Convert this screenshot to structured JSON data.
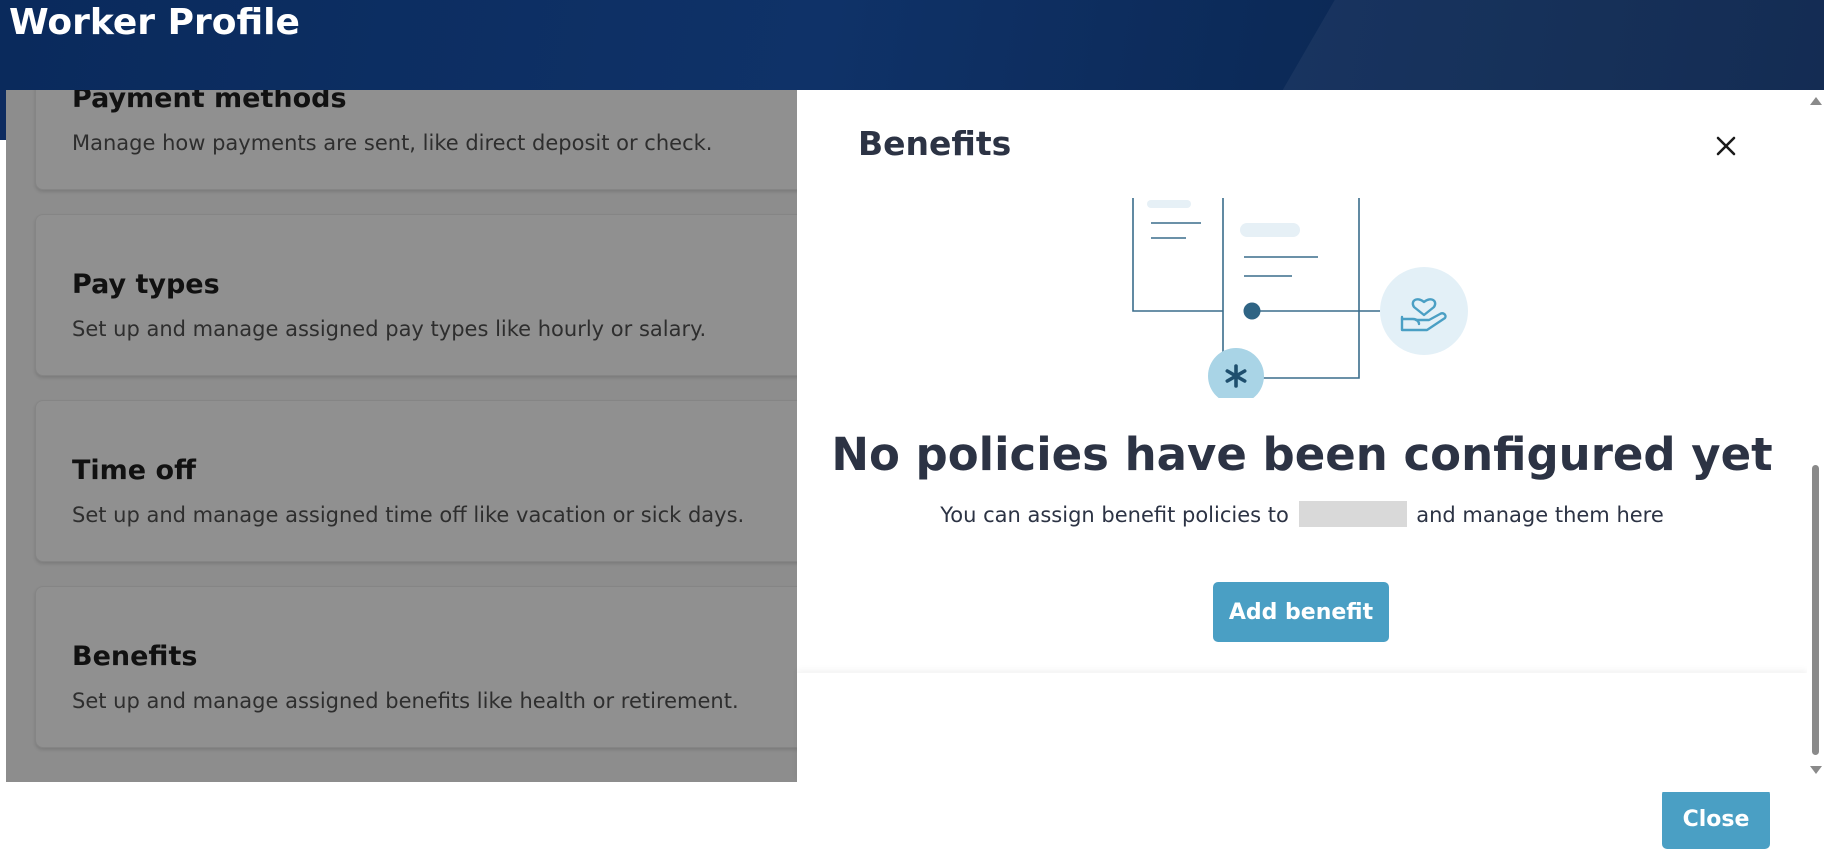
{
  "header": {
    "title": "Worker Profile"
  },
  "cards": [
    {
      "title": "Payment methods",
      "description": "Manage how payments are sent, like direct deposit or check."
    },
    {
      "title": "Pay types",
      "description": "Set up and manage assigned pay types like hourly or salary."
    },
    {
      "title": "Time off",
      "description": "Set up and manage assigned time off like vacation or sick days."
    },
    {
      "title": "Benefits",
      "description": "Set up and manage assigned benefits like health or retirement."
    }
  ],
  "panel": {
    "title": "Benefits",
    "empty_title": "No policies have been configured yet",
    "empty_desc_before": "You can assign benefit policies to",
    "empty_desc_after": "and manage them here",
    "add_button": "Add benefit",
    "close_button": "Close"
  },
  "colors": {
    "header_bg": "#0f3268",
    "accent_button": "#4a9fc4",
    "illustration_line": "#3a6d8c",
    "illustration_circle": "#a9d4e6",
    "title_text": "#2c3344"
  },
  "icons": {
    "close": "close-icon",
    "asterisk": "asterisk-icon",
    "benefit": "hand-heart-icon"
  }
}
